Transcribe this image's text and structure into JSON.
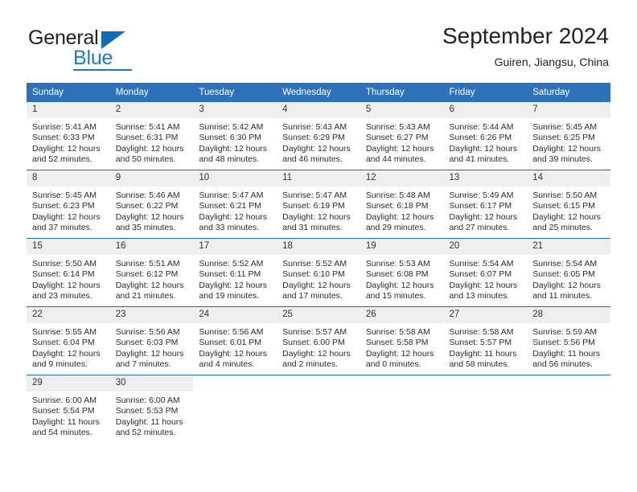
{
  "brand": {
    "word_one": "General",
    "word_two": "Blue",
    "mark": "triangle-logo"
  },
  "header": {
    "title": "September 2024",
    "location": "Guiren, Jiangsu, China"
  },
  "calendar": {
    "weekday_headers": [
      "Sunday",
      "Monday",
      "Tuesday",
      "Wednesday",
      "Thursday",
      "Friday",
      "Saturday"
    ],
    "colors": {
      "header_bar": "#2d72b8",
      "row_separator": "#1f69b3",
      "daynum_band": "#efefef",
      "brand_blue": "#1e7cc4"
    },
    "weeks": [
      [
        {
          "day": "1",
          "sunrise": "Sunrise: 5:41 AM",
          "sunset": "Sunset: 6:33 PM",
          "daylight_line1": "Daylight: 12 hours",
          "daylight_line2": "and 52 minutes."
        },
        {
          "day": "2",
          "sunrise": "Sunrise: 5:41 AM",
          "sunset": "Sunset: 6:31 PM",
          "daylight_line1": "Daylight: 12 hours",
          "daylight_line2": "and 50 minutes."
        },
        {
          "day": "3",
          "sunrise": "Sunrise: 5:42 AM",
          "sunset": "Sunset: 6:30 PM",
          "daylight_line1": "Daylight: 12 hours",
          "daylight_line2": "and 48 minutes."
        },
        {
          "day": "4",
          "sunrise": "Sunrise: 5:43 AM",
          "sunset": "Sunset: 6:29 PM",
          "daylight_line1": "Daylight: 12 hours",
          "daylight_line2": "and 46 minutes."
        },
        {
          "day": "5",
          "sunrise": "Sunrise: 5:43 AM",
          "sunset": "Sunset: 6:27 PM",
          "daylight_line1": "Daylight: 12 hours",
          "daylight_line2": "and 44 minutes."
        },
        {
          "day": "6",
          "sunrise": "Sunrise: 5:44 AM",
          "sunset": "Sunset: 6:26 PM",
          "daylight_line1": "Daylight: 12 hours",
          "daylight_line2": "and 41 minutes."
        },
        {
          "day": "7",
          "sunrise": "Sunrise: 5:45 AM",
          "sunset": "Sunset: 6:25 PM",
          "daylight_line1": "Daylight: 12 hours",
          "daylight_line2": "and 39 minutes."
        }
      ],
      [
        {
          "day": "8",
          "sunrise": "Sunrise: 5:45 AM",
          "sunset": "Sunset: 6:23 PM",
          "daylight_line1": "Daylight: 12 hours",
          "daylight_line2": "and 37 minutes."
        },
        {
          "day": "9",
          "sunrise": "Sunrise: 5:46 AM",
          "sunset": "Sunset: 6:22 PM",
          "daylight_line1": "Daylight: 12 hours",
          "daylight_line2": "and 35 minutes."
        },
        {
          "day": "10",
          "sunrise": "Sunrise: 5:47 AM",
          "sunset": "Sunset: 6:21 PM",
          "daylight_line1": "Daylight: 12 hours",
          "daylight_line2": "and 33 minutes."
        },
        {
          "day": "11",
          "sunrise": "Sunrise: 5:47 AM",
          "sunset": "Sunset: 6:19 PM",
          "daylight_line1": "Daylight: 12 hours",
          "daylight_line2": "and 31 minutes."
        },
        {
          "day": "12",
          "sunrise": "Sunrise: 5:48 AM",
          "sunset": "Sunset: 6:18 PM",
          "daylight_line1": "Daylight: 12 hours",
          "daylight_line2": "and 29 minutes."
        },
        {
          "day": "13",
          "sunrise": "Sunrise: 5:49 AM",
          "sunset": "Sunset: 6:17 PM",
          "daylight_line1": "Daylight: 12 hours",
          "daylight_line2": "and 27 minutes."
        },
        {
          "day": "14",
          "sunrise": "Sunrise: 5:50 AM",
          "sunset": "Sunset: 6:15 PM",
          "daylight_line1": "Daylight: 12 hours",
          "daylight_line2": "and 25 minutes."
        }
      ],
      [
        {
          "day": "15",
          "sunrise": "Sunrise: 5:50 AM",
          "sunset": "Sunset: 6:14 PM",
          "daylight_line1": "Daylight: 12 hours",
          "daylight_line2": "and 23 minutes."
        },
        {
          "day": "16",
          "sunrise": "Sunrise: 5:51 AM",
          "sunset": "Sunset: 6:12 PM",
          "daylight_line1": "Daylight: 12 hours",
          "daylight_line2": "and 21 minutes."
        },
        {
          "day": "17",
          "sunrise": "Sunrise: 5:52 AM",
          "sunset": "Sunset: 6:11 PM",
          "daylight_line1": "Daylight: 12 hours",
          "daylight_line2": "and 19 minutes."
        },
        {
          "day": "18",
          "sunrise": "Sunrise: 5:52 AM",
          "sunset": "Sunset: 6:10 PM",
          "daylight_line1": "Daylight: 12 hours",
          "daylight_line2": "and 17 minutes."
        },
        {
          "day": "19",
          "sunrise": "Sunrise: 5:53 AM",
          "sunset": "Sunset: 6:08 PM",
          "daylight_line1": "Daylight: 12 hours",
          "daylight_line2": "and 15 minutes."
        },
        {
          "day": "20",
          "sunrise": "Sunrise: 5:54 AM",
          "sunset": "Sunset: 6:07 PM",
          "daylight_line1": "Daylight: 12 hours",
          "daylight_line2": "and 13 minutes."
        },
        {
          "day": "21",
          "sunrise": "Sunrise: 5:54 AM",
          "sunset": "Sunset: 6:05 PM",
          "daylight_line1": "Daylight: 12 hours",
          "daylight_line2": "and 11 minutes."
        }
      ],
      [
        {
          "day": "22",
          "sunrise": "Sunrise: 5:55 AM",
          "sunset": "Sunset: 6:04 PM",
          "daylight_line1": "Daylight: 12 hours",
          "daylight_line2": "and 9 minutes."
        },
        {
          "day": "23",
          "sunrise": "Sunrise: 5:56 AM",
          "sunset": "Sunset: 6:03 PM",
          "daylight_line1": "Daylight: 12 hours",
          "daylight_line2": "and 7 minutes."
        },
        {
          "day": "24",
          "sunrise": "Sunrise: 5:56 AM",
          "sunset": "Sunset: 6:01 PM",
          "daylight_line1": "Daylight: 12 hours",
          "daylight_line2": "and 4 minutes."
        },
        {
          "day": "25",
          "sunrise": "Sunrise: 5:57 AM",
          "sunset": "Sunset: 6:00 PM",
          "daylight_line1": "Daylight: 12 hours",
          "daylight_line2": "and 2 minutes."
        },
        {
          "day": "26",
          "sunrise": "Sunrise: 5:58 AM",
          "sunset": "Sunset: 5:58 PM",
          "daylight_line1": "Daylight: 12 hours",
          "daylight_line2": "and 0 minutes."
        },
        {
          "day": "27",
          "sunrise": "Sunrise: 5:58 AM",
          "sunset": "Sunset: 5:57 PM",
          "daylight_line1": "Daylight: 11 hours",
          "daylight_line2": "and 58 minutes."
        },
        {
          "day": "28",
          "sunrise": "Sunrise: 5:59 AM",
          "sunset": "Sunset: 5:56 PM",
          "daylight_line1": "Daylight: 11 hours",
          "daylight_line2": "and 56 minutes."
        }
      ],
      [
        {
          "day": "29",
          "sunrise": "Sunrise: 6:00 AM",
          "sunset": "Sunset: 5:54 PM",
          "daylight_line1": "Daylight: 11 hours",
          "daylight_line2": "and 54 minutes."
        },
        {
          "day": "30",
          "sunrise": "Sunrise: 6:00 AM",
          "sunset": "Sunset: 5:53 PM",
          "daylight_line1": "Daylight: 11 hours",
          "daylight_line2": "and 52 minutes."
        },
        {
          "day": "",
          "sunrise": "",
          "sunset": "",
          "daylight_line1": "",
          "daylight_line2": ""
        },
        {
          "day": "",
          "sunrise": "",
          "sunset": "",
          "daylight_line1": "",
          "daylight_line2": ""
        },
        {
          "day": "",
          "sunrise": "",
          "sunset": "",
          "daylight_line1": "",
          "daylight_line2": ""
        },
        {
          "day": "",
          "sunrise": "",
          "sunset": "",
          "daylight_line1": "",
          "daylight_line2": ""
        },
        {
          "day": "",
          "sunrise": "",
          "sunset": "",
          "daylight_line1": "",
          "daylight_line2": ""
        }
      ]
    ]
  }
}
